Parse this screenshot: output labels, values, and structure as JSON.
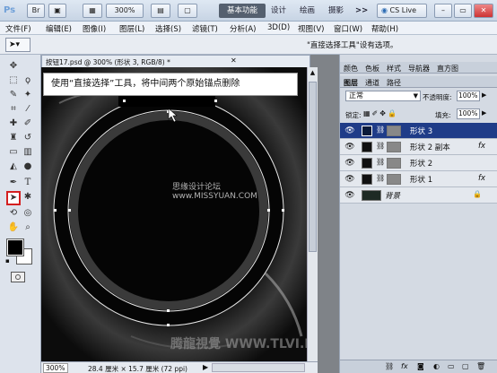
{
  "app": {
    "logo": "Ps",
    "zoom": "300%"
  },
  "titlebar": {
    "workspace_active": "基本功能",
    "workspace_items": [
      "设计",
      "绘画",
      "摄影"
    ],
    "more": ">>",
    "cslive": "CS Live"
  },
  "menu": [
    "文件(F)",
    "编辑(E)",
    "图像(I)",
    "图层(L)",
    "选择(S)",
    "滤镜(T)",
    "分析(A)",
    "3D(D)",
    "视图(V)",
    "窗口(W)",
    "帮助(H)"
  ],
  "options": {
    "message": "\"直接选择工具\"设有选项。"
  },
  "document": {
    "tab_title": "按钮17.psd @ 300% (形状 3, RGB/8) *",
    "status_zoom": "300%",
    "status_size": "28.4 厘米 × 15.7 厘米 (72 ppi)"
  },
  "callout": {
    "text": "使用“直接选择”工具，将中间两个原始锚点删除"
  },
  "watermarks": {
    "mid": "思缘设计论坛 www.MISSYUAN.COM",
    "bottom": "腾龍視覺 WWW.TLVI.NET"
  },
  "panels": {
    "top_tabs": [
      "颜色",
      "色板",
      "样式",
      "导航器",
      "直方图"
    ],
    "tabs": [
      "图层",
      "通道",
      "路径"
    ],
    "blend_mode": "正常",
    "opacity_label": "不透明度:",
    "opacity_value": "100%",
    "lock_label": "锁定:",
    "fill_label": "填充:",
    "fill_value": "100%",
    "layers": [
      {
        "name": "形状 3",
        "selected": true,
        "fx": false
      },
      {
        "name": "形状 2 副本",
        "selected": false,
        "fx": true
      },
      {
        "name": "形状 2",
        "selected": false,
        "fx": false
      },
      {
        "name": "形状 1",
        "selected": false,
        "fx": true
      },
      {
        "name": "背景",
        "selected": false,
        "fx": false,
        "locked": true
      }
    ],
    "fx_label": "fx"
  },
  "colors": {
    "selected_layer": "#1f3c88",
    "accent_red": "#d42020"
  }
}
